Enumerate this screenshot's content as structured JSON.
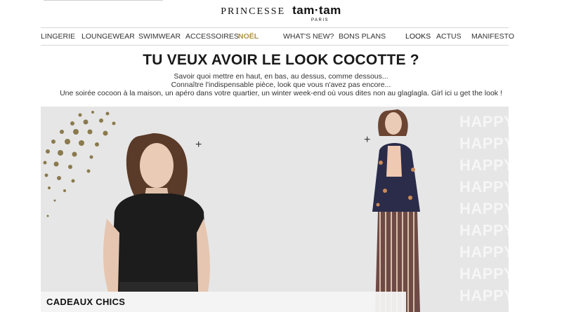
{
  "brand": {
    "name_left": "PRINCESSE",
    "name_right": "tam·tam",
    "subtitle": "PARIS"
  },
  "nav": {
    "items": [
      {
        "label": "LINGERIE"
      },
      {
        "label": "LOUNGEWEAR"
      },
      {
        "label": "SWIMWEAR"
      },
      {
        "label": "ACCESSOIRES"
      },
      {
        "label": "NOËL"
      },
      {
        "label": "WHAT'S NEW?"
      },
      {
        "label": "BONS PLANS"
      },
      {
        "label": "LOOKS"
      },
      {
        "label": "ACTUS"
      },
      {
        "label": "MANIFESTO"
      }
    ]
  },
  "headline": "TU VEUX AVOIR LE LOOK COCOTTE ?",
  "intro": {
    "line1": "Savoir quoi mettre en haut, en bas, au dessus, comme dessous...",
    "line2": "Connaître l'indispensable pièce, look que vous n'avez pas encore...",
    "line3": "Une soirée cocoon à la maison, un apéro dans votre quartier, un winter week-end où vous dites non au glaglagla. Girl ici u get the look !"
  },
  "hero": {
    "plus_symbol": "+",
    "happy_text": [
      "HAPPY",
      "HAPPY",
      "HAPPY",
      "HAPPY",
      "HAPPY",
      "HAPPY",
      "HAPPY",
      "HAPPY",
      "HAPPY"
    ],
    "caption": "CADEAUX CHICS"
  },
  "colors": {
    "accent_noel": "#b39149",
    "dots": "#8a7a4e",
    "hero_bg": "#e6e6e6"
  }
}
